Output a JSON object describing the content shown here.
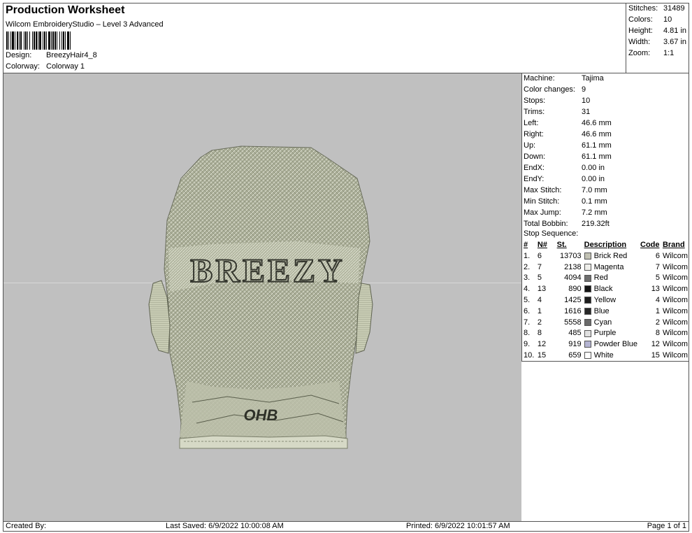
{
  "header": {
    "title": "Production Worksheet",
    "subtitle": "Wilcom EmbroideryStudio – Level 3 Advanced",
    "design_label": "Design:",
    "design_value": "BreezyHair4_8",
    "colorway_label": "Colorway:",
    "colorway_value": "Colorway 1"
  },
  "stats": {
    "stitches_label": "Stitches:",
    "stitches_value": "31489",
    "colors_label": "Colors:",
    "colors_value": "10",
    "height_label": "Height:",
    "height_value": "4.81 in",
    "width_label": "Width:",
    "width_value": "3.67 in",
    "zoom_label": "Zoom:",
    "zoom_value": "1:1"
  },
  "design_art": {
    "hair_text": "BREEZY",
    "neck_text": "OHB"
  },
  "info": {
    "machine_label": "Machine:",
    "machine_value": "Tajima",
    "color_changes_label": "Color changes:",
    "color_changes_value": "9",
    "stops_label": "Stops:",
    "stops_value": "10",
    "trims_label": "Trims:",
    "trims_value": "31",
    "left_label": "Left:",
    "left_value": "46.6 mm",
    "right_label": "Right:",
    "right_value": "46.6 mm",
    "up_label": "Up:",
    "up_value": "61.1 mm",
    "down_label": "Down:",
    "down_value": "61.1 mm",
    "endx_label": "EndX:",
    "endx_value": "0.00 in",
    "endy_label": "EndY:",
    "endy_value": "0.00 in",
    "max_stitch_label": "Max Stitch:",
    "max_stitch_value": "7.0 mm",
    "min_stitch_label": "Min Stitch:",
    "min_stitch_value": "0.1 mm",
    "max_jump_label": "Max Jump:",
    "max_jump_value": "7.2 mm",
    "total_bobbin_label": "Total Bobbin:",
    "total_bobbin_value": "219.32ft",
    "stop_sequence_label": "Stop Sequence:"
  },
  "stop_table": {
    "headers": {
      "index": "#",
      "needle": "N#",
      "st": "St.",
      "description": "Description",
      "code": "Code",
      "brand": "Brand"
    },
    "rows": [
      {
        "index": "1.",
        "needle": "6",
        "st": "13703",
        "description": "Brick Red",
        "code": "6",
        "brand": "Wilcom",
        "color": "#c2c2b4"
      },
      {
        "index": "2.",
        "needle": "7",
        "st": "2138",
        "description": "Magenta",
        "code": "7",
        "brand": "Wilcom",
        "color": "#eeeeea"
      },
      {
        "index": "3.",
        "needle": "5",
        "st": "4094",
        "description": "Red",
        "code": "5",
        "brand": "Wilcom",
        "color": "#6e6e6e"
      },
      {
        "index": "4.",
        "needle": "13",
        "st": "890",
        "description": "Black",
        "code": "13",
        "brand": "Wilcom",
        "color": "#141414"
      },
      {
        "index": "5.",
        "needle": "4",
        "st": "1425",
        "description": "Yellow",
        "code": "4",
        "brand": "Wilcom",
        "color": "#1e1e1e"
      },
      {
        "index": "6.",
        "needle": "1",
        "st": "1616",
        "description": "Blue",
        "code": "1",
        "brand": "Wilcom",
        "color": "#282828"
      },
      {
        "index": "7.",
        "needle": "2",
        "st": "5558",
        "description": "Cyan",
        "code": "2",
        "brand": "Wilcom",
        "color": "#6a6a6a"
      },
      {
        "index": "8.",
        "needle": "8",
        "st": "485",
        "description": "Purple",
        "code": "8",
        "brand": "Wilcom",
        "color": "#e0e0e0"
      },
      {
        "index": "9.",
        "needle": "12",
        "st": "919",
        "description": "Powder Blue",
        "code": "12",
        "brand": "Wilcom",
        "color": "#b4b4d2"
      },
      {
        "index": "10.",
        "needle": "15",
        "st": "659",
        "description": "White",
        "code": "15",
        "brand": "Wilcom",
        "color": "#ffffff"
      }
    ]
  },
  "footer": {
    "created_by": "Created By:",
    "last_saved": "Last Saved: 6/9/2022 10:00:08 AM",
    "printed": "Printed: 6/9/2022 10:01:57 AM",
    "page": "Page 1 of 1"
  }
}
